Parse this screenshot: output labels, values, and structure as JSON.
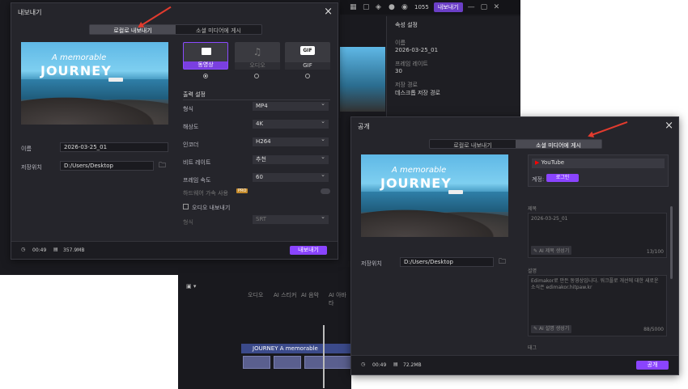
{
  "bg": {
    "credits": "1055",
    "upgrade_label": "내보내기",
    "side_tab": "속성 설정",
    "props": [
      "이름",
      "2026-03-25_01",
      "프레임 레이트",
      "30",
      "저장 경로",
      "데스크톱 저장 경로"
    ],
    "tools": [
      "오디오",
      "AI 스티커",
      "AI 음악",
      "AI 아바타"
    ],
    "timeline_title": "JOURNEY A memorable"
  },
  "export": {
    "title": "내보내기",
    "tabs": [
      "로컬로 내보내기",
      "소셜 미디어에 게시"
    ],
    "active_tab": 0,
    "thumb_small": "A memorable",
    "thumb_big": "JOURNEY",
    "name_label": "이름",
    "name_value": "2026-03-25_01",
    "path_label": "저장위치",
    "path_value": "D:/Users/Desktop",
    "formats": [
      "동영상",
      "오디오",
      "GIF"
    ],
    "gif_badge": "GIF",
    "section": "출력 설정",
    "rows": [
      {
        "label": "형식",
        "value": "MP4"
      },
      {
        "label": "해상도",
        "value": "4K"
      },
      {
        "label": "인코더",
        "value": "H264"
      },
      {
        "label": "비트 레이트",
        "value": "추천"
      },
      {
        "label": "프레임 속도",
        "value": "60"
      }
    ],
    "hw_label": "하드웨어 가속 사용",
    "hw_badge": "PRO",
    "audio_check": "오디오 내보내기",
    "audio_label": "형식",
    "audio_value": "SRT",
    "duration": "00:49",
    "size": "357.9MB",
    "export_btn": "내보내기"
  },
  "publish": {
    "title": "공개",
    "tabs": [
      "로컬로 내보내기",
      "소셜 미디어에 게시"
    ],
    "active_tab": 1,
    "thumb_small": "A memorable",
    "thumb_big": "JOURNEY",
    "platform": "YouTube",
    "account_label": "계정:",
    "login_btn": "로그인",
    "title_label": "제목",
    "title_value": "2026-03-25_01",
    "ai_title": "AI 제목 생성기",
    "title_count": "13/100",
    "desc_label": "설명",
    "desc_value": "Edimakor로 만든 동영상입니다. 워크플로 개선에 대한 새로운 소식은 edimakor.hitpaw.kr",
    "ai_desc": "AI 설명 생성기",
    "desc_count": "88/5000",
    "tag_label": "태그",
    "path_label": "저장위치",
    "path_value": "D:/Users/Desktop",
    "duration": "00:49",
    "size": "72.2MB",
    "publish_btn": "공개"
  },
  "colors": {
    "accent": "#8a44ff",
    "arrow": "#e23b2e",
    "youtube": "#ff0000"
  }
}
